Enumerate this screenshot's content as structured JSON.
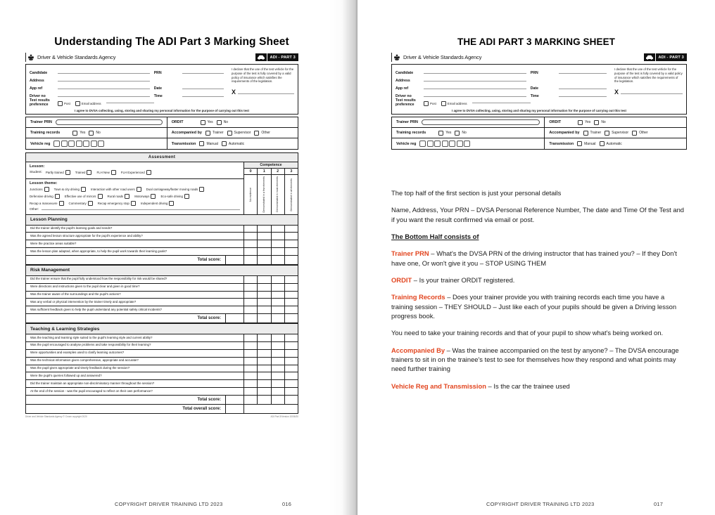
{
  "spread": {
    "left_page": {
      "title": "Understanding The ADI Part 3 Marking Sheet",
      "footer": {
        "copyright": "COPYRIGHT DRIVER TRAINING LTD 2023",
        "page_number": "016"
      }
    },
    "right_page": {
      "title": "THE ADI PART 3 MARKING SHEET",
      "footer": {
        "copyright": "COPYRIGHT DRIVER TRAINING LTD 2023",
        "page_number": "017"
      }
    }
  },
  "form": {
    "brand": "Driver & Vehicle Standards Agency",
    "badge": "ADI - PART 3",
    "crest_icon": "royal-crest-icon",
    "car_icon": "car-icon",
    "personal": {
      "labels": {
        "candidate": "Candidate",
        "address": "Address",
        "app_ref": "App ref",
        "driver_no": "Driver no",
        "test_results_preference": "Test results preference",
        "prn": "PRN",
        "date": "Date",
        "time": "Time"
      },
      "pref_options": [
        "Post",
        "Email address"
      ],
      "declaration": "I declare that the use of the test vehicle for the purpose of the test is fully covered by a valid policy of insurance which satisfies the requirements of the legislation.",
      "signature_mark": "X",
      "agree": "I agree to DVSA collecting, using, storing and sharing my personal information for the purpose of carrying out this test"
    },
    "trainer": {
      "trainer_prn_label": "Trainer PRN",
      "ordit_label": "ORDIT",
      "ordit_options": [
        "Yes",
        "No"
      ],
      "training_records_label": "Training records",
      "training_records_options": [
        "Yes",
        "No"
      ],
      "accompanied_label": "Accompanied by",
      "accompanied_options": [
        "Trainer",
        "Supervisor",
        "Other"
      ],
      "vehicle_reg_label": "Vehicle reg",
      "vehicle_reg_cells": 7,
      "transmission_label": "Transmission",
      "transmission_options": [
        "Manual",
        "Automatic"
      ]
    },
    "assessment": {
      "title": "Assessment",
      "competence_header": "Competence",
      "competence_numbers": [
        "0",
        "1",
        "2",
        "3"
      ],
      "competence_descriptions": [
        "No evidence",
        "Demonstrated in a few elements",
        "Demonstrated in most elements",
        "Demonstrated in all elements"
      ],
      "lesson": {
        "heading": "Lesson:",
        "student_label": "Student:",
        "student_options": [
          "Partly trained",
          "Trained",
          "FLH New",
          "FLH Experienced"
        ]
      },
      "lesson_theme": {
        "heading": "Lesson theme:",
        "row1": [
          "Junctions",
          "Town & city driving",
          "Interaction with other road users",
          "Dual carriageway/faster moving roads"
        ],
        "row2": [
          "Defensive driving",
          "Effective use of mirrors",
          "Rural roads",
          "Motorways",
          "Eco-safe driving"
        ],
        "row3": [
          "Recap a manoeuvre",
          "Commentary",
          "Recap emergency stop",
          "Independent driving"
        ],
        "other_label": "Other:"
      },
      "sections": [
        {
          "name": "Lesson Planning",
          "questions": [
            "Did the trainer identify the pupil's learning goals and needs?",
            "Was the agreed lesson structure appropriate for the pupil's experience and ability?",
            "Were the practice areas suitable?",
            "Was the lesson plan adapted, when appropriate, to help the pupil work towards their learning goals?"
          ],
          "total_label": "Total score:"
        },
        {
          "name": "Risk Management",
          "questions": [
            "Did the trainer ensure that the pupil fully understood how the responsibility for risk would be shared?",
            "Were directions and instructions given to the pupil clear and given in good time?",
            "Was the trainer aware of the surroundings and the pupil's actions?",
            "Was any verbal or physical intervention by the trainer timely and appropriate?",
            "Was sufficient feedback given to help the pupil understand any potential safety critical incidents?"
          ],
          "total_label": "Total score:"
        },
        {
          "name": "Teaching & Learning Strategies",
          "questions": [
            "Was the teaching and learning style suited to the pupil's learning style and current ability?",
            "Was the pupil encouraged  to analyse problems and take responsibility for their learning?",
            "Were opportunities and examples used to clarify learning outcomes?",
            "Was the technical information given comprehensive, appropriate and accurate?",
            "Was the pupil given appropriate and timely feedback during the session?",
            "Were the pupil's queries followed up and answered?",
            "Did the trainer maintain an appropriate non-discriminatory manner throughout the session?",
            "At the end of the session - was the pupil encouraged to reflect on their own performance?"
          ],
          "total_label": "Total score:"
        }
      ],
      "overall_label": "Total overall score:"
    },
    "footer_left": "Driver and Vehicle Standards Agency © Crown copyright 2020",
    "footer_right": "ADI Part 3/Version 10/06/20"
  },
  "article": {
    "paragraphs": [
      {
        "type": "plain",
        "text": "The top half of the first section is just your personal details"
      },
      {
        "type": "plain",
        "text": "Name, Address, Your PRN – DVSA Personal Reference Number, The date and Time Of the Test and if you want the result confirmed via email or post."
      },
      {
        "type": "heading",
        "text": "The Bottom Half consists of"
      },
      {
        "type": "keyed",
        "keyword": "Trainer PRN",
        "text": " – What's the DVSA PRN of the driving instructor that has trained you? – If they Don't have one, Or won't give it you – STOP USING THEM"
      },
      {
        "type": "keyed",
        "keyword": "ORDIT",
        "text": " – Is your trainer ORDIT registered."
      },
      {
        "type": "keyed",
        "keyword": "Training Records",
        "text": " – Does your trainer provide you with training records each time you have a training session – THEY SHOULD – Just like each of your pupils should be given a Driving lesson progress book."
      },
      {
        "type": "plain",
        "text": "You need to take your training records and that of your pupil to show what's being worked on."
      },
      {
        "type": "keyed",
        "keyword": "Accompanied By",
        "text": " – Was the trainee accompanied on the test by anyone? – The DVSA encourage trainers to sit in on the trainee's test to see for themselves how they respond and what points may need further training"
      },
      {
        "type": "keyed",
        "keyword": "Vehicle Reg and Transmission",
        "text": " – Is the car the trainee used"
      }
    ]
  },
  "colors": {
    "keyword": "#e2451f",
    "rule": "#1c1c1c",
    "section_bg": "#ececec"
  }
}
